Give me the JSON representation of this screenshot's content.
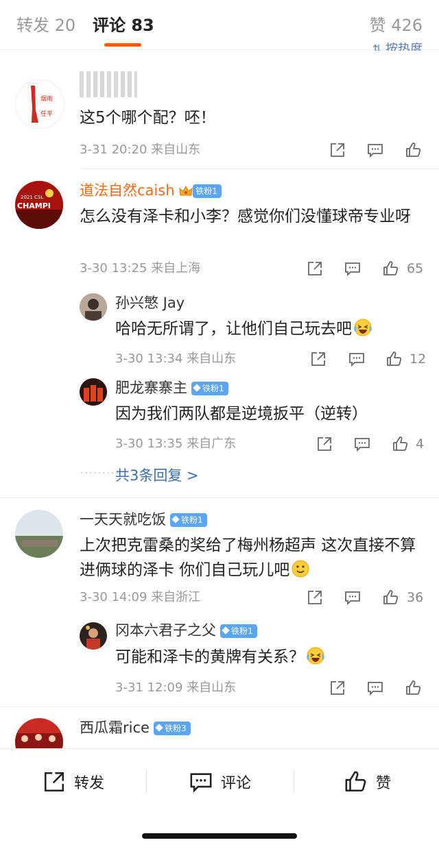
{
  "tabs": {
    "repost": "转发 20",
    "comment": "评论 83",
    "likes": "赞 426"
  },
  "sort_label": "按热度",
  "comments": [
    {
      "id": 1,
      "text": "这5个哪个配？呸！",
      "time": "3-31 20:20",
      "location": "来自山东",
      "likes": ""
    },
    {
      "id": 2,
      "name": "道法自然caish",
      "badge": "铁粉1",
      "text": "怎么没有泽卡和小李？感觉你们没懂球帝专业呀",
      "time": "3-30 13:25",
      "location": "来自上海",
      "likes": "65",
      "replies": [
        {
          "name": "孙兴慜 Jay",
          "text": "哈哈无所谓了，让他们自己玩去吧",
          "time": "3-30 13:34",
          "location": "来自山东",
          "likes": "12"
        },
        {
          "name": "肥龙寨寨主",
          "badge": "铁粉1",
          "text": "因为我们两队都是逆境扳平（逆转）",
          "time": "3-30 13:35",
          "location": "来自广东",
          "likes": "4"
        }
      ],
      "more_replies": "共3条回复 >"
    },
    {
      "id": 3,
      "name": "一天天就吃饭",
      "badge": "铁粉1",
      "text": "上次把克雷桑的奖给了梅州杨超声 这次直接不算进俩球的泽卡 你们自己玩儿吧",
      "time": "3-30 14:09",
      "location": "来自浙江",
      "likes": "36",
      "replies": [
        {
          "name": "冈本六君子之父",
          "badge": "铁粉1",
          "text": "可能和泽卡的黄牌有关系？",
          "time": "3-31 12:09",
          "location": "来自山东",
          "likes": ""
        }
      ]
    },
    {
      "id": 4,
      "name": "西瓜霜rice",
      "badge": "铁粉3"
    }
  ],
  "avatar_text": {
    "c1": "一 戳 烟 雨 任 平 生",
    "c2_top": "2021 CSL",
    "c2_main": "CHAMPIONS"
  },
  "bottom_bar": {
    "repost": "转发",
    "comment": "评论",
    "like": "赞"
  }
}
